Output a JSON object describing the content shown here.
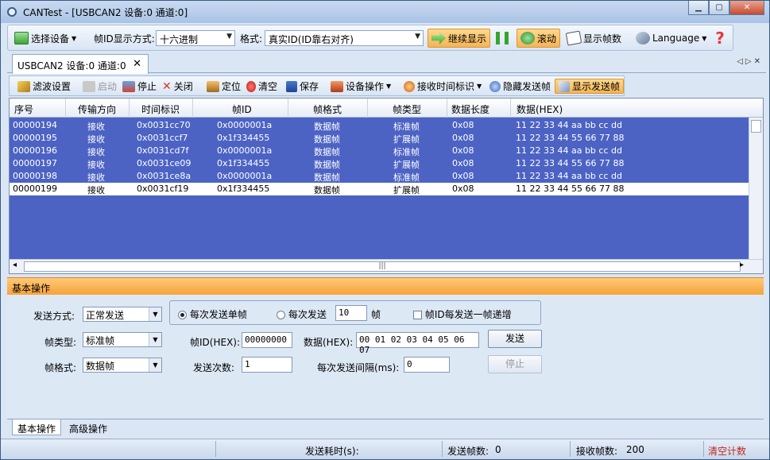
{
  "window": {
    "title": "CANTest - [USBCAN2 设备:0 通道:0]"
  },
  "toolbar": {
    "select_device": "选择设备",
    "frame_id_display_label": "帧ID显示方式:",
    "frame_id_display_value": "十六进制",
    "format_label": "格式:",
    "format_value": "真实ID(ID靠右对齐)",
    "continue_display": "继续显示",
    "scroll": "滚动",
    "show_frame_count": "显示帧数",
    "language": "Language"
  },
  "doc_tab": {
    "label": "USBCAN2 设备:0 通道:0"
  },
  "toolbar2": {
    "filter_settings": "滤波设置",
    "start": "启动",
    "stop": "停止",
    "close": "关闭",
    "locate": "定位",
    "clear": "清空",
    "save": "保存",
    "device_ops": "设备操作",
    "rx_time_mark": "接收时间标识",
    "hide_send_frames": "隐藏发送帧",
    "show_send_frames": "显示发送帧"
  },
  "grid": {
    "columns": [
      "序号",
      "传输方向",
      "时间标识",
      "帧ID",
      "帧格式",
      "帧类型",
      "数据长度",
      "数据(HEX)"
    ],
    "rows": [
      [
        "00000194",
        "接收",
        "0x0031cc70",
        "0x0000001a",
        "数据帧",
        "标准帧",
        "0x08",
        "11 22 33 44 aa bb cc dd"
      ],
      [
        "00000195",
        "接收",
        "0x0031ccf7",
        "0x1f334455",
        "数据帧",
        "扩展帧",
        "0x08",
        "11 22 33 44 55 66 77 88"
      ],
      [
        "00000196",
        "接收",
        "0x0031cd7f",
        "0x0000001a",
        "数据帧",
        "标准帧",
        "0x08",
        "11 22 33 44 aa bb cc dd"
      ],
      [
        "00000197",
        "接收",
        "0x0031ce09",
        "0x1f334455",
        "数据帧",
        "扩展帧",
        "0x08",
        "11 22 33 44 55 66 77 88"
      ],
      [
        "00000198",
        "接收",
        "0x0031ce8a",
        "0x0000001a",
        "数据帧",
        "标准帧",
        "0x08",
        "11 22 33 44 aa bb cc dd"
      ],
      [
        "00000199",
        "接收",
        "0x0031cf19",
        "0x1f334455",
        "数据帧",
        "扩展帧",
        "0x08",
        "11 22 33 44 55 66 77 88"
      ]
    ]
  },
  "panel": {
    "header": "基本操作",
    "send_mode_label": "发送方式:",
    "send_mode_value": "正常发送",
    "send_single_label": "每次发送单帧",
    "send_each_label": "每次发送",
    "send_each_value": "10",
    "frame_unit": "帧",
    "id_increment_label": "帧ID每发送一帧递增",
    "frame_type_label": "帧类型:",
    "frame_type_value": "标准帧",
    "frame_id_label": "帧ID(HEX):",
    "frame_id_value": "00000000",
    "data_label": "数据(HEX):",
    "data_value": "00 01 02 03 04 05 06 07",
    "send_button": "发送",
    "frame_format_label": "帧格式:",
    "frame_format_value": "数据帧",
    "send_count_label": "发送次数:",
    "send_count_value": "1",
    "interval_label": "每次发送间隔(ms):",
    "interval_value": "0",
    "stop_button": "停止"
  },
  "bottom_tabs": [
    "基本操作",
    "高级操作"
  ],
  "status": {
    "send_time_label": "发送耗时(s):",
    "send_time_value": "",
    "sent_frames_label": "发送帧数:",
    "sent_frames_value": "0",
    "recv_frames_label": "接收帧数:",
    "recv_frames_value": "200",
    "clear_count": "清空计数"
  },
  "colors": {
    "grid_bg": "#4c63c4",
    "panel_header": "#f5a33b",
    "highlight": "#ffd88c"
  }
}
